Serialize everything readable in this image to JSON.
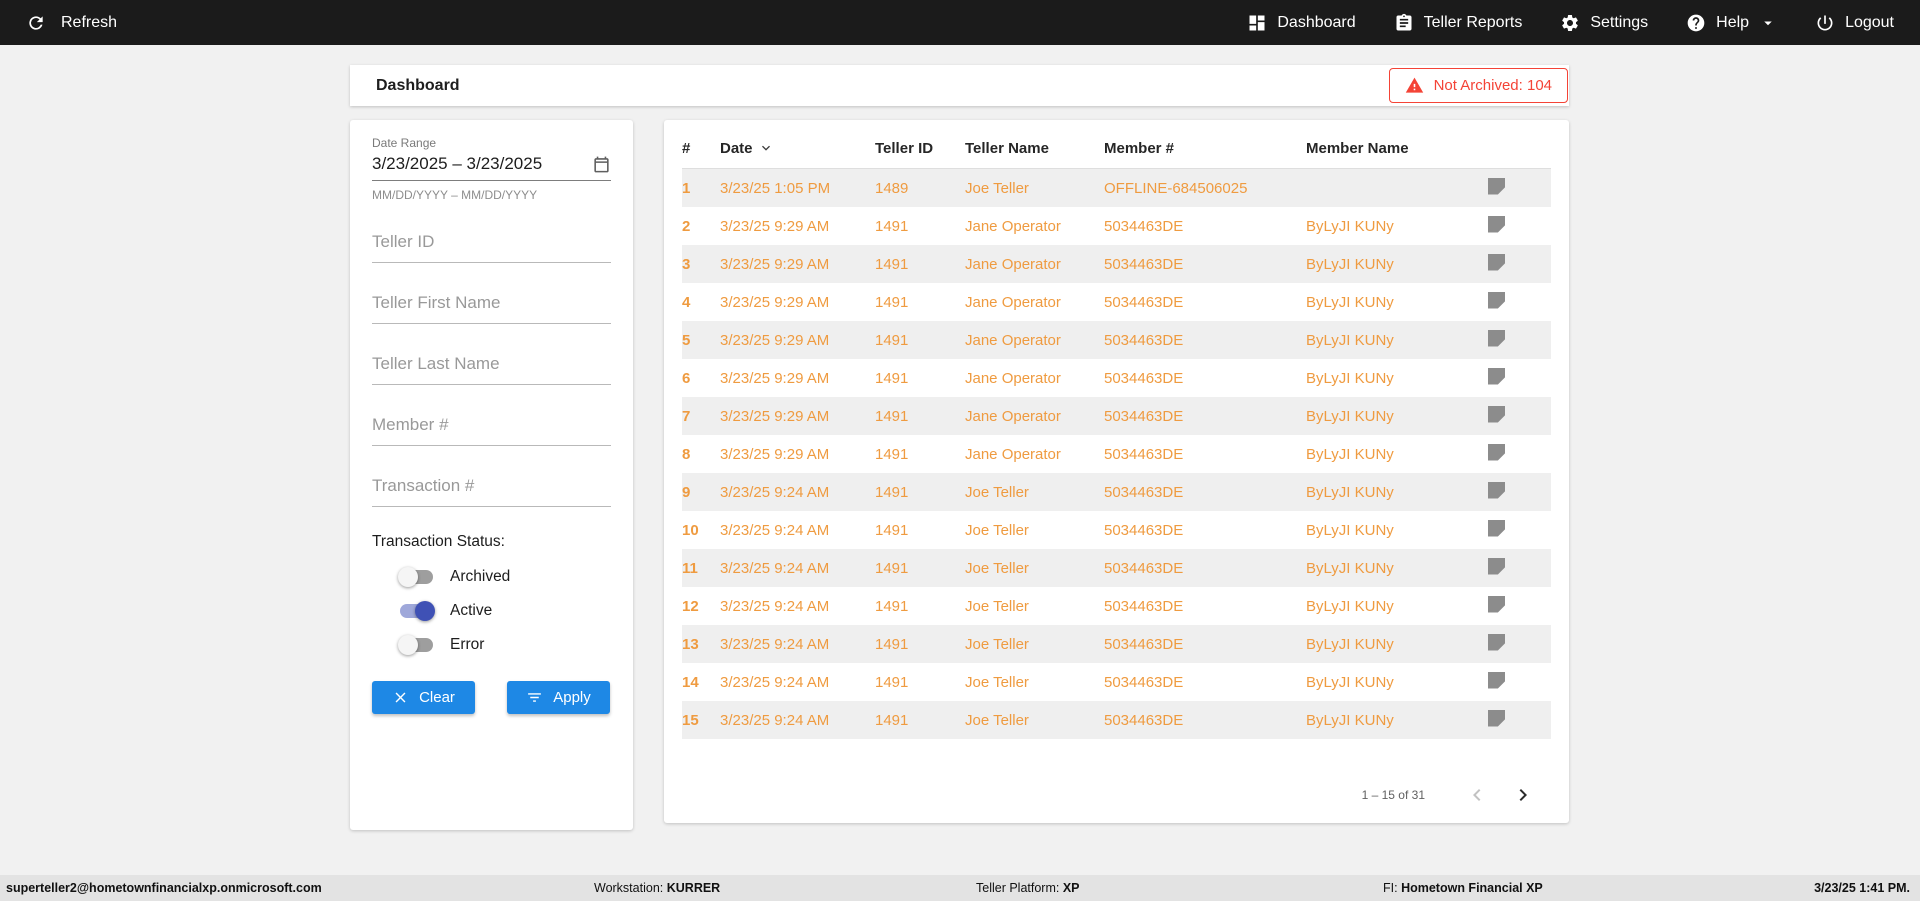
{
  "colors": {
    "accent_orange": "#ef9b40",
    "accent_blue": "#1e88e5",
    "toggle_blue": "#3f51b5",
    "alert_red": "#f44336"
  },
  "navbar": {
    "refresh_label": "Refresh",
    "items": [
      {
        "label": "Dashboard",
        "icon": "dashboard-grid-icon"
      },
      {
        "label": "Teller Reports",
        "icon": "clipboard-list-icon"
      },
      {
        "label": "Settings",
        "icon": "gear-icon"
      },
      {
        "label": "Help",
        "icon": "question-circle-icon",
        "chevron": "chevron-down-icon"
      },
      {
        "label": "Logout",
        "icon": "power-icon"
      }
    ]
  },
  "header": {
    "title": "Dashboard",
    "not_archived_label": "Not Archived: 104",
    "not_archived_icon": "warning-triangle-icon"
  },
  "filters": {
    "date_range_label": "Date Range",
    "date_range_value": "3/23/2025 – 3/23/2025",
    "date_range_icon": "calendar-icon",
    "date_range_hint": "MM/DD/YYYY – MM/DD/YYYY",
    "teller_id_placeholder": "Teller ID",
    "teller_first_name_placeholder": "Teller First Name",
    "teller_last_name_placeholder": "Teller Last Name",
    "member_placeholder": "Member #",
    "transaction_placeholder": "Transaction #",
    "status_label": "Transaction Status:",
    "toggles": [
      {
        "label": "Archived",
        "on": false
      },
      {
        "label": "Active",
        "on": true
      },
      {
        "label": "Error",
        "on": false
      }
    ],
    "clear_label": "Clear",
    "clear_icon": "close-icon",
    "apply_label": "Apply",
    "apply_icon": "filter-lines-icon"
  },
  "table": {
    "columns": [
      "#",
      "Date",
      "Teller ID",
      "Teller Name",
      "Member #",
      "Member Name"
    ],
    "sort_column": "Date",
    "row_icon": "note-icon",
    "rows": [
      {
        "num": "1",
        "date": "3/23/25 1:05 PM",
        "teller_id": "1489",
        "teller_name": "Joe Teller",
        "member": "OFFLINE-684506025",
        "member_name": ""
      },
      {
        "num": "2",
        "date": "3/23/25 9:29 AM",
        "teller_id": "1491",
        "teller_name": "Jane Operator",
        "member": "5034463DE",
        "member_name": "ByLyJI KUNy"
      },
      {
        "num": "3",
        "date": "3/23/25 9:29 AM",
        "teller_id": "1491",
        "teller_name": "Jane Operator",
        "member": "5034463DE",
        "member_name": "ByLyJI KUNy"
      },
      {
        "num": "4",
        "date": "3/23/25 9:29 AM",
        "teller_id": "1491",
        "teller_name": "Jane Operator",
        "member": "5034463DE",
        "member_name": "ByLyJI KUNy"
      },
      {
        "num": "5",
        "date": "3/23/25 9:29 AM",
        "teller_id": "1491",
        "teller_name": "Jane Operator",
        "member": "5034463DE",
        "member_name": "ByLyJI KUNy"
      },
      {
        "num": "6",
        "date": "3/23/25 9:29 AM",
        "teller_id": "1491",
        "teller_name": "Jane Operator",
        "member": "5034463DE",
        "member_name": "ByLyJI KUNy"
      },
      {
        "num": "7",
        "date": "3/23/25 9:29 AM",
        "teller_id": "1491",
        "teller_name": "Jane Operator",
        "member": "5034463DE",
        "member_name": "ByLyJI KUNy"
      },
      {
        "num": "8",
        "date": "3/23/25 9:29 AM",
        "teller_id": "1491",
        "teller_name": "Jane Operator",
        "member": "5034463DE",
        "member_name": "ByLyJI KUNy"
      },
      {
        "num": "9",
        "date": "3/23/25 9:24 AM",
        "teller_id": "1491",
        "teller_name": "Joe Teller",
        "member": "5034463DE",
        "member_name": "ByLyJI KUNy"
      },
      {
        "num": "10",
        "date": "3/23/25 9:24 AM",
        "teller_id": "1491",
        "teller_name": "Joe Teller",
        "member": "5034463DE",
        "member_name": "ByLyJI KUNy"
      },
      {
        "num": "11",
        "date": "3/23/25 9:24 AM",
        "teller_id": "1491",
        "teller_name": "Joe Teller",
        "member": "5034463DE",
        "member_name": "ByLyJI KUNy"
      },
      {
        "num": "12",
        "date": "3/23/25 9:24 AM",
        "teller_id": "1491",
        "teller_name": "Joe Teller",
        "member": "5034463DE",
        "member_name": "ByLyJI KUNy"
      },
      {
        "num": "13",
        "date": "3/23/25 9:24 AM",
        "teller_id": "1491",
        "teller_name": "Joe Teller",
        "member": "5034463DE",
        "member_name": "ByLyJI KUNy"
      },
      {
        "num": "14",
        "date": "3/23/25 9:24 AM",
        "teller_id": "1491",
        "teller_name": "Joe Teller",
        "member": "5034463DE",
        "member_name": "ByLyJI KUNy"
      },
      {
        "num": "15",
        "date": "3/23/25 9:24 AM",
        "teller_id": "1491",
        "teller_name": "Joe Teller",
        "member": "5034463DE",
        "member_name": "ByLyJI KUNy"
      }
    ],
    "pagination": {
      "range_label": "1 – 15 of 31",
      "prev_icon": "chevron-left-icon",
      "next_icon": "chevron-right-icon"
    }
  },
  "footer": {
    "email": "superteller2@hometownfinancialxp.onmicrosoft.com",
    "workstation_label": "Workstation:",
    "workstation_value": "KURRER",
    "platform_label": "Teller Platform:",
    "platform_value": "XP",
    "fi_label": "FI:",
    "fi_value": "Hometown Financial XP",
    "datetime": "3/23/25 1:41 PM."
  }
}
